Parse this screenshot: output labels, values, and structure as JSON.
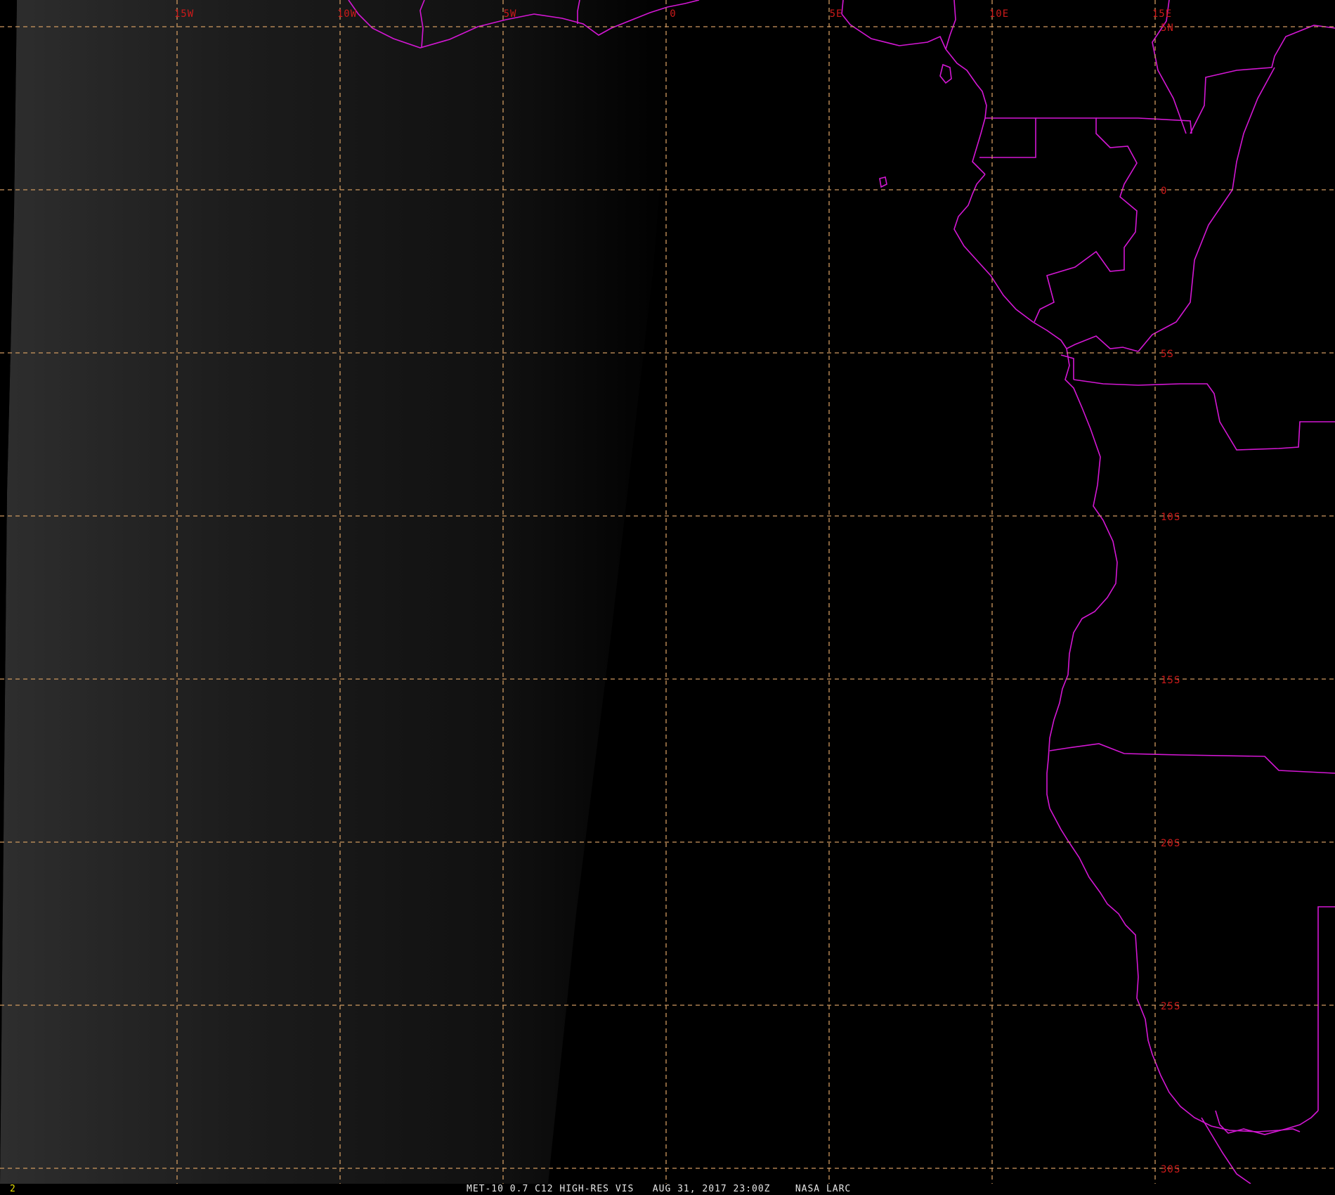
{
  "colors": {
    "grid": "#d09a60",
    "grid_label": "#cc1a1a",
    "borders": "#d417d4",
    "caption": "#e6e6e6",
    "frame_number": "#e8e000",
    "background": "#000000"
  },
  "map": {
    "projection": "geostationary",
    "longitudes": [
      {
        "value": -15,
        "label": "15W"
      },
      {
        "value": -10,
        "label": "10W"
      },
      {
        "value": -5,
        "label": "5W"
      },
      {
        "value": 0,
        "label": "0"
      },
      {
        "value": 5,
        "label": "5E"
      },
      {
        "value": 10,
        "label": "10E"
      },
      {
        "value": 15,
        "label": "15E"
      }
    ],
    "latitudes": [
      {
        "value": 5,
        "label": "5N"
      },
      {
        "value": 0,
        "label": "0"
      },
      {
        "value": -5,
        "label": "5S"
      },
      {
        "value": -10,
        "label": "10S"
      },
      {
        "value": -15,
        "label": "15S"
      },
      {
        "value": -20,
        "label": "20S"
      },
      {
        "value": -25,
        "label": "25S"
      },
      {
        "value": -30,
        "label": "30S"
      }
    ]
  },
  "footer": {
    "frame_number": "2",
    "caption": "MET-10 0.7 C12 HIGH-RES VIS   AUG 31, 2017 23:00Z    NASA LARC"
  }
}
